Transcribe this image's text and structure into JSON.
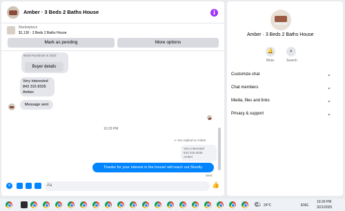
{
  "header": {
    "title": "Amber · 3 Beds 2 Baths House"
  },
  "marketplace": {
    "label": "Marketplace",
    "listing": "$1,130 · 3 Beds 2 Baths House",
    "mark_pending": "Mark as pending",
    "more_options": "More options"
  },
  "messages": {
    "listed_note": "listed Facebook in 2023",
    "buyer_details": "Buyer details",
    "m1_line1": "Very interested",
    "m1_line2": "843 315 8335",
    "m1_line3": "Amber",
    "m2": "Message sent",
    "time": "10:29 PM",
    "replied_label": "You replied to Amber",
    "quoted_line1": "Very interested",
    "quoted_line2": "843 315 8335",
    "quoted_line3": "Amber",
    "my_message": "Thanks for your interest in the house! will reach out Shortly.",
    "status": "Sent"
  },
  "composer": {
    "placeholder": "Aa"
  },
  "sidebar": {
    "name": "Amber · 3 Beds 2 Baths House",
    "mute": "Mute",
    "search": "Search",
    "rows": [
      "Customize chat",
      "Chat members",
      "Media, files and links",
      "Privacy & support"
    ]
  },
  "taskbar": {
    "weather": "24°C",
    "lang": "ENG",
    "time": "10:29 PM",
    "date": "3/21/2025"
  },
  "colors": {
    "accent": "#0084ff",
    "info": "#a033ff"
  }
}
